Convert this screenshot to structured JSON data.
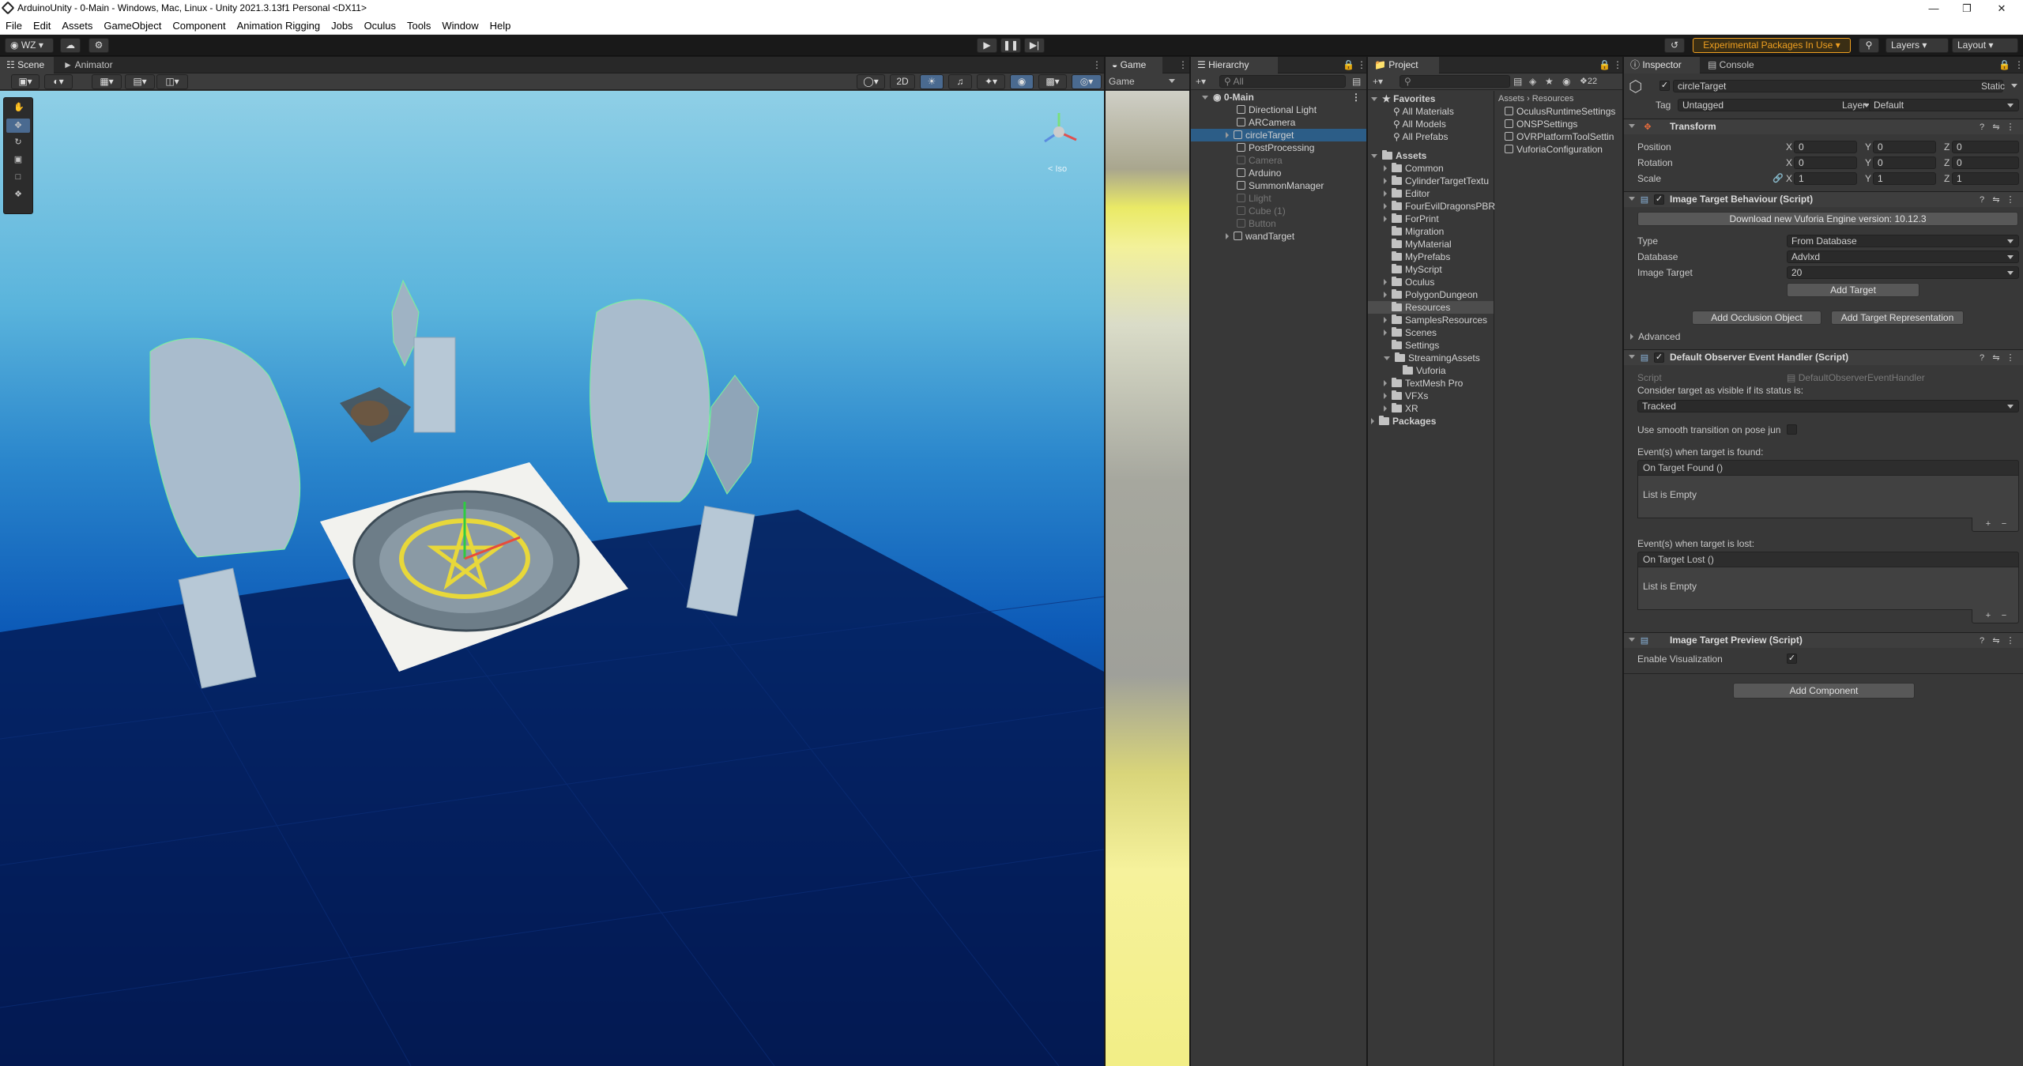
{
  "window": {
    "title": "ArduinoUnity - 0-Main - Windows, Mac, Linux - Unity 2021.3.13f1 Personal <DX11>"
  },
  "menu": [
    "File",
    "Edit",
    "Assets",
    "GameObject",
    "Component",
    "Animation Rigging",
    "Jobs",
    "Oculus",
    "Tools",
    "Window",
    "Help"
  ],
  "toolbar": {
    "account": "WZ",
    "experimental": "Experimental Packages In Use",
    "layers": "Layers",
    "layout": "Layout"
  },
  "scene": {
    "tabs": [
      "Scene",
      "Animator"
    ],
    "toggle_2d": "2D",
    "persp": "< Iso"
  },
  "game": {
    "tab": "Game",
    "display": "Game"
  },
  "hierarchy": {
    "tab": "Hierarchy",
    "search_placeholder": "All",
    "root": "0-Main",
    "items": [
      "Directional Light",
      "ARCamera",
      "circleTarget",
      "PostProcessing",
      "Camera",
      "Arduino",
      "SummonManager",
      "Llight",
      "Cube (1)",
      "Button",
      "wandTarget"
    ]
  },
  "project": {
    "tab": "Project",
    "count": "22",
    "favorites_label": "Favorites",
    "favorites": [
      "All Materials",
      "All Models",
      "All Prefabs"
    ],
    "assets_label": "Assets",
    "folders": [
      "Common",
      "CylinderTargetTextu",
      "Editor",
      "FourEvilDragonsPBR",
      "ForPrint",
      "Migration",
      "MyMaterial",
      "MyPrefabs",
      "MyScript",
      "Oculus",
      "PolygonDungeon",
      "Resources",
      "SamplesResources",
      "Scenes",
      "Settings",
      "StreamingAssets",
      "Vuforia",
      "TextMesh Pro",
      "VFXs",
      "XR"
    ],
    "packages_label": "Packages",
    "breadcrumb": [
      "Assets",
      "Resources"
    ],
    "files": [
      "OculusRuntimeSettings",
      "ONSPSettings",
      "OVRPlatformToolSettin",
      "VuforiaConfiguration"
    ]
  },
  "inspector": {
    "tabs": [
      "Inspector",
      "Console"
    ],
    "object_name": "circleTarget",
    "static_label": "Static",
    "tag_label": "Tag",
    "tag_value": "Untagged",
    "layer_label": "Layer",
    "layer_value": "Default",
    "transform": {
      "title": "Transform",
      "position_label": "Position",
      "rotation_label": "Rotation",
      "scale_label": "Scale",
      "x": "X",
      "y": "Y",
      "z": "Z",
      "position": [
        "0",
        "0",
        "0"
      ],
      "rotation": [
        "0",
        "0",
        "0"
      ],
      "scale": [
        "1",
        "1",
        "1"
      ]
    },
    "itb": {
      "title": "Image Target Behaviour (Script)",
      "download_button": "Download new Vuforia Engine version: 10.12.3",
      "type_label": "Type",
      "type_value": "From Database",
      "database_label": "Database",
      "database_value": "Advlxd",
      "image_target_label": "Image Target",
      "image_target_value": "20",
      "add_target": "Add Target",
      "add_occlusion": "Add Occlusion Object",
      "add_representation": "Add Target Representation",
      "advanced": "Advanced"
    },
    "doeh": {
      "title": "Default Observer Event Handler (Script)",
      "script_label": "Script",
      "script_value": "DefaultObserverEventHandler",
      "consider_label": "Consider target as visible if its status is:",
      "tracked": "Tracked",
      "smooth_label": "Use smooth transition on pose jun",
      "found_label": "Event(s) when target is found:",
      "on_found": "On Target Found ()",
      "list_empty_1": "List is Empty",
      "lost_label": "Event(s) when target is lost:",
      "on_lost": "On Target Lost ()",
      "list_empty_2": "List is Empty",
      "plus": "+",
      "minus": "−"
    },
    "itp": {
      "title": "Image Target Preview (Script)",
      "enable_label": "Enable Visualization"
    },
    "add_component": "Add Component"
  }
}
